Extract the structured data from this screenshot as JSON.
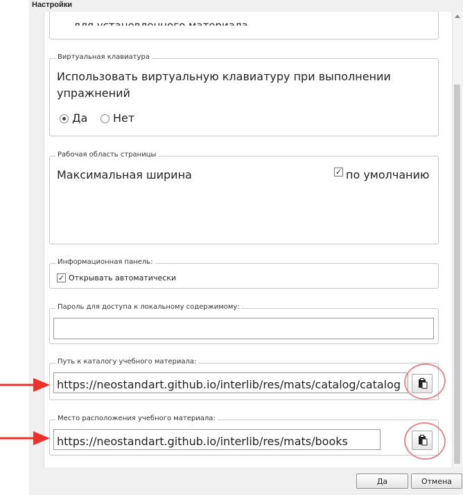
{
  "window": {
    "title": "Настройки"
  },
  "top_group": {
    "partial_text": "для установленного материала"
  },
  "virtual_keyboard": {
    "legend": "Виртуальная клавиатура",
    "question": "Использовать виртуальную клавиатуру при выполнении упражнений",
    "options": [
      {
        "label": "Да",
        "selected": true
      },
      {
        "label": "Нет",
        "selected": false
      }
    ]
  },
  "work_area": {
    "legend": "Рабочая область страницы",
    "label": "Максимальная ширина",
    "default_label": "по умолчанию",
    "default_checked": true
  },
  "info_panel": {
    "legend": "Информационная панель:",
    "auto_open_label": "Открывать автоматически",
    "auto_open_checked": true
  },
  "password": {
    "legend": "Пароль для доступа к локальному содержимому:",
    "value": ""
  },
  "catalog_path": {
    "legend": "Путь к каталогу учебного материала:",
    "value": "https://neostandart.github.io/interlib/res/mats/catalog/catalog",
    "paste_icon": "clipboard-paste-icon"
  },
  "material_location": {
    "legend": "Место расположения учебного материала:",
    "value": "https://neostandart.github.io/interlib/res/mats/books",
    "paste_icon": "clipboard-paste-icon"
  },
  "footer": {
    "ok_label": "Да",
    "cancel_label": "Отмена"
  },
  "colors": {
    "annotation_red": "#e8322b",
    "circle_pink": "#e38a8e"
  }
}
